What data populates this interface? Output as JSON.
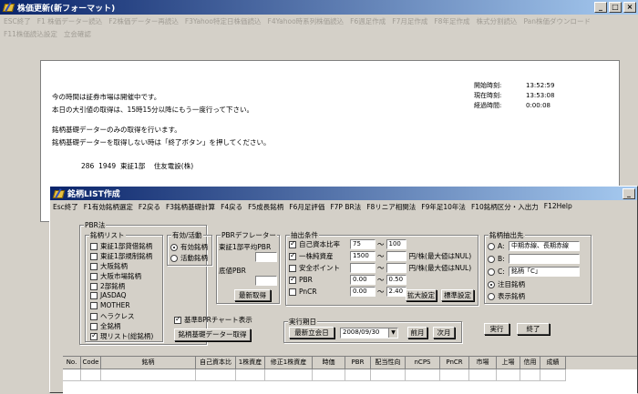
{
  "win1": {
    "title": "株価更新(新フォーマット)",
    "menu": [
      "ESC終了",
      "F1 株価データー読込",
      "F2株価データー再読込",
      "F3Yahoo特定日株価読込",
      "F4Yahoo時系列株価読込",
      "F6週足作成",
      "F7月足作成",
      "F8年足作成",
      "株式分割読込",
      "Pan株価ダウンロード",
      "F11株価読込設定",
      "立会確認"
    ],
    "messages": [
      "今の時間は証券市場は開催中です。",
      "本日の大引値の取得は、15時15分以降にもう一度行って下さい。",
      "銘柄基礎データーのみの取得を行います。",
      "銘柄基礎データーを取得しない時は「終了ボタン」を押してください。"
    ],
    "progress": {
      "index": "286",
      "code": "1949",
      "market": "東証1部",
      "name": "住友電設(株)"
    },
    "times": {
      "start_label": "開始時刻:",
      "start": "13:52:59",
      "now_label": "現在時刻:",
      "now": "13:53:08",
      "elapsed_label": "経過時間:",
      "elapsed": "0:00:08"
    }
  },
  "win2": {
    "title": "銘柄LIST作成",
    "menu": [
      "Esc終了",
      "F1有効銘柄選定",
      "F2戻る",
      "F3銘柄基礎計算",
      "F4戻る",
      "F5成長銘柄",
      "F6月足評価",
      "F7P BR法",
      "F8リニア相関法",
      "F9年足10年法",
      "F10銘柄区分・入出力",
      "F12Help"
    ],
    "pbr_group": "PBR法",
    "list_group": "銘柄リスト",
    "list_items": [
      {
        "label": "東証1部貸借銘柄",
        "checked": false
      },
      {
        "label": "東証1部規制銘柄",
        "checked": false
      },
      {
        "label": "大阪銘柄",
        "checked": false
      },
      {
        "label": "大阪市場銘柄",
        "checked": false
      },
      {
        "label": "2部銘柄",
        "checked": false
      },
      {
        "label": "JASDAQ",
        "checked": false
      },
      {
        "label": "MOTHER",
        "checked": false
      },
      {
        "label": "ヘラクレス",
        "checked": false
      },
      {
        "label": "全銘柄",
        "checked": false
      },
      {
        "label": "現リスト(総銘柄)",
        "checked": true
      }
    ],
    "active_group": "有効/活動",
    "active_valid": "有効銘柄",
    "active_activity": "活動銘柄",
    "deflator_group": "PBRデフレーター",
    "deflator_avg": "東証1部平均PBR",
    "deflator_floor": "底値PBR",
    "latest_button": "最新取得",
    "extract_group": "抽出条件",
    "conditions": [
      {
        "label": "自己資本比率",
        "checked": true,
        "from": "75",
        "to": "100",
        "unit": ""
      },
      {
        "label": "一株純資産",
        "checked": true,
        "from": "1500",
        "to": "",
        "unit": "円/株(最大値はNUL)"
      },
      {
        "label": "安全ポイント",
        "checked": false,
        "from": "",
        "to": "",
        "unit": "円/株(最大値はNUL)"
      },
      {
        "label": "PBR",
        "checked": true,
        "from": "0.00",
        "to": "0.50",
        "unit": ""
      },
      {
        "label": "PnCR",
        "checked": false,
        "from": "0.00",
        "to": "2.40",
        "unit": ""
      }
    ],
    "tilde": "〜",
    "expand_button": "拡大設定",
    "standard_button": "標準設定",
    "dest_group": "銘柄抽出先",
    "dest_a": "A:",
    "dest_a_value": "中期赤線、長期赤線",
    "dest_b": "B:",
    "dest_b_value": "",
    "dest_c": "C:",
    "dest_c_value": "銘柄「C」",
    "dest_note": "注目銘柄",
    "dest_show": "表示銘柄",
    "chart_check": "基準BPRチャート表示",
    "basic_button": "銘柄基礎データー取得",
    "period_group": "実行期日",
    "latest_date_button": "最新立会日",
    "date_value": "2008/09/30",
    "prev_button": "前月",
    "next_button": "次月",
    "run_button": "実行",
    "end_button": "終了",
    "columns": [
      "No.",
      "Code",
      "銘柄",
      "自己資本比",
      "1株資産",
      "修正1株資産",
      "時価",
      "PBR",
      "配当性向",
      "nCPS",
      "PnCR",
      "市場",
      "上場",
      "信用",
      "成績"
    ]
  }
}
